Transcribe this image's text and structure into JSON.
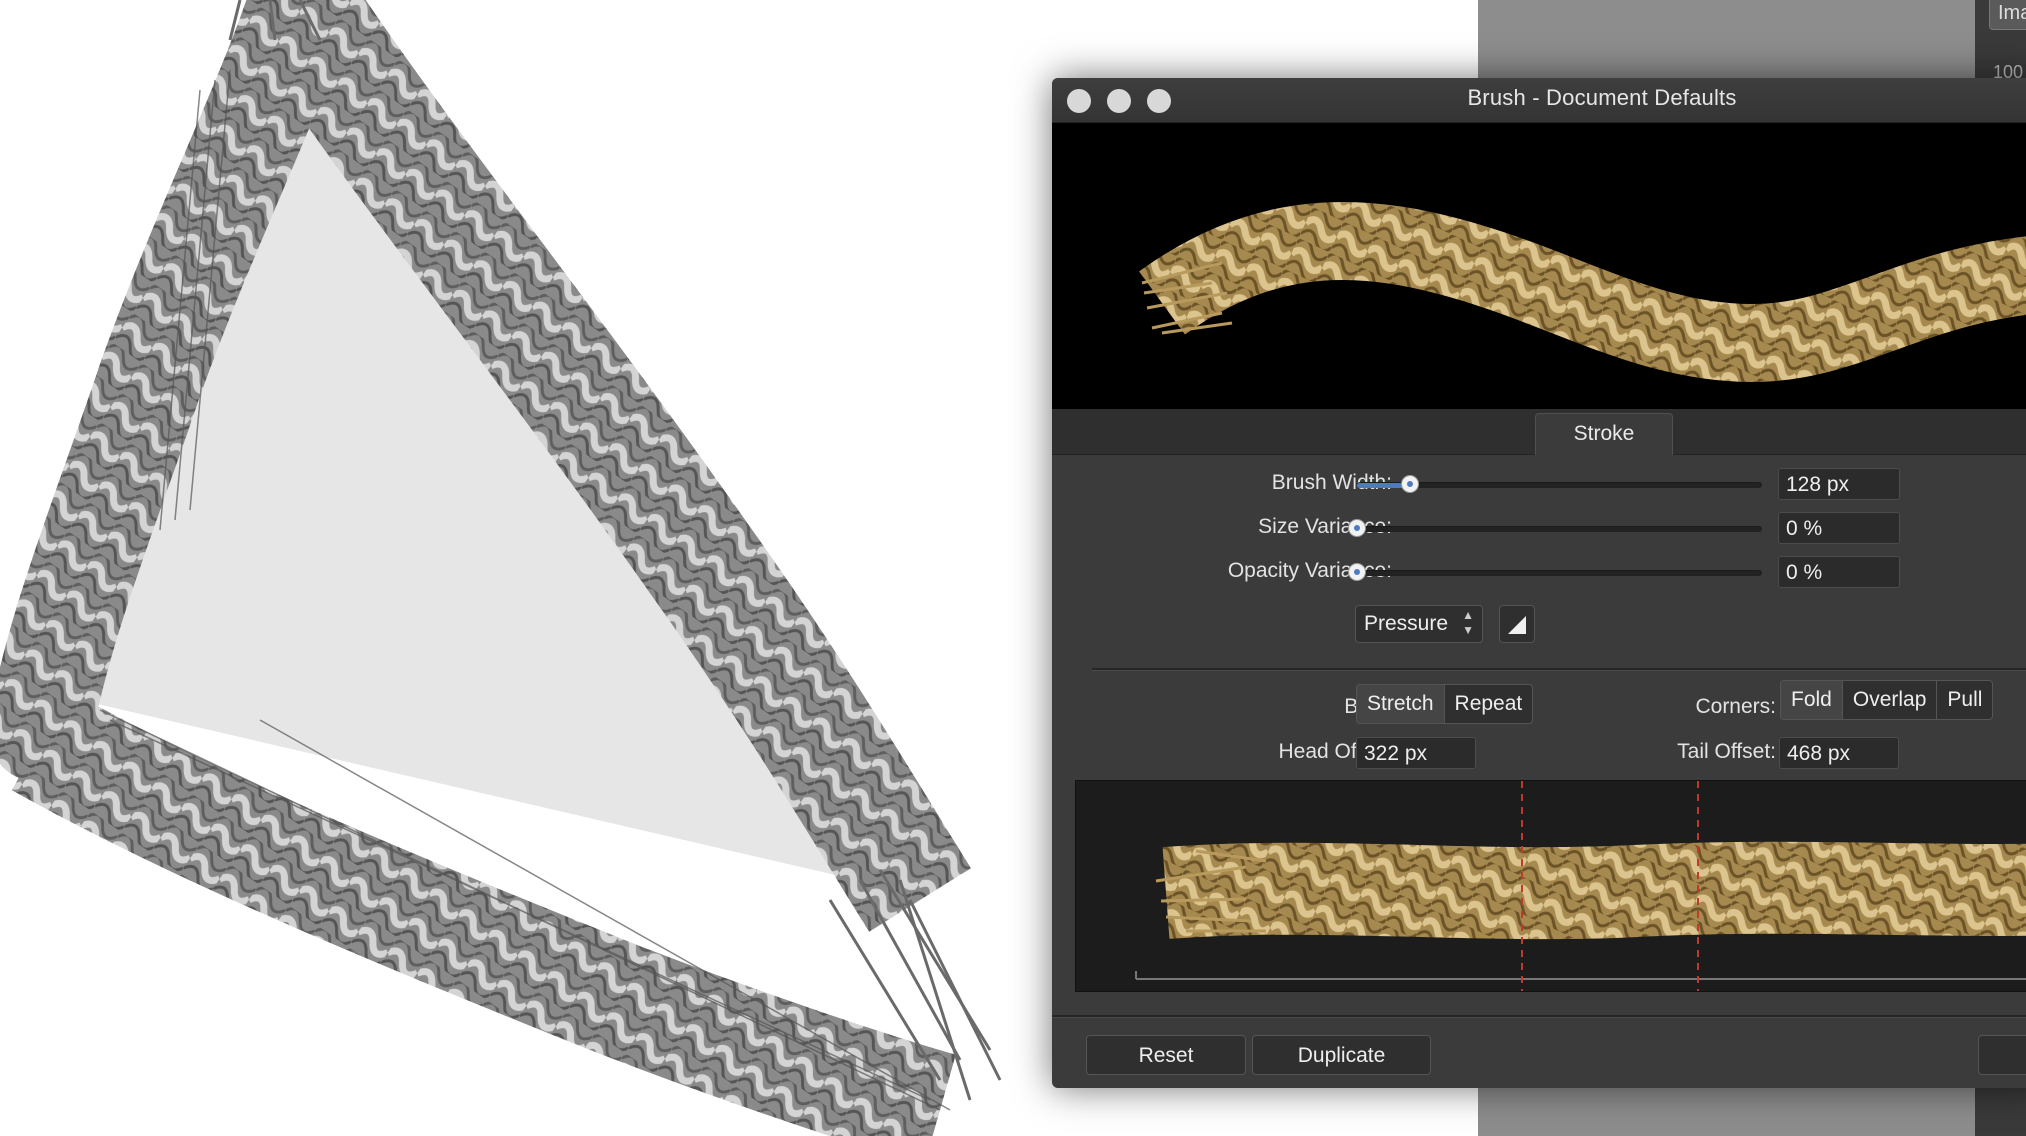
{
  "window": {
    "title": "Brush - Document Defaults",
    "tab_label": "Stroke"
  },
  "stroke": {
    "brush_width": {
      "label": "Brush Width:",
      "value": "128 px",
      "slider_fraction": 0.13
    },
    "size_variance": {
      "label": "Size Variance:",
      "value": "0 %",
      "slider_fraction": 0.0
    },
    "opacity_variance": {
      "label": "Opacity Variance:",
      "value": "0 %",
      "slider_fraction": 0.0
    },
    "controller": {
      "selected": "Pressure"
    }
  },
  "body": {
    "label": "Body:",
    "options": [
      "Stretch",
      "Repeat"
    ],
    "selected": "Stretch"
  },
  "corners": {
    "label": "Corners:",
    "options": [
      "Fold",
      "Overlap",
      "Pull"
    ],
    "selected": "Fold"
  },
  "offsets": {
    "head_label": "Head Offset:",
    "head_value": "322 px",
    "tail_label": "Tail Offset:",
    "tail_value": "468 px"
  },
  "buttons": {
    "reset": "Reset",
    "duplicate": "Duplicate"
  },
  "side_panel": {
    "button_label": "Ima",
    "value_label": "100"
  },
  "colors": {
    "dialog_bg": "#3b3b3b",
    "accent": "#4e7bc0",
    "rope": "#c4a86c",
    "guide": "#c0392b"
  }
}
